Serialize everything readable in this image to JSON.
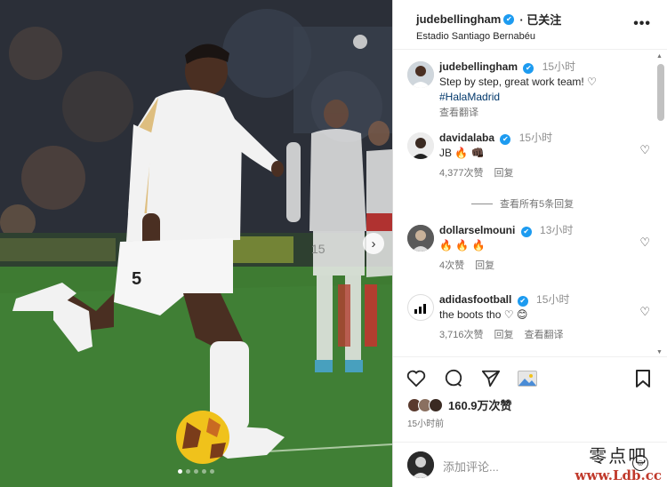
{
  "post": {
    "author": "judebellingham",
    "follow_state": "· 已关注",
    "location": "Estadio Santiago Bernabéu",
    "more": "•••",
    "photo": {
      "shirt_number": "5",
      "shirt_number_bg": "15",
      "carousel_dots": 5,
      "active_dot": 1
    }
  },
  "comments": [
    {
      "user": "judebellingham",
      "time": "15小时",
      "text": "Step by step, great work team! ♡",
      "hashtag": "#HalaMadrid",
      "translate": "查看翻译"
    },
    {
      "user": "davidalaba",
      "time": "15小时",
      "text": "JB 🔥 👊🏿",
      "likes": "4,377次赞",
      "reply": "回复",
      "view_replies": "查看所有5条回复"
    },
    {
      "user": "dollarselmouni",
      "time": "13小时",
      "text": "🔥 🔥 🔥",
      "likes": "4次赞",
      "reply": "回复"
    },
    {
      "user": "adidasfootball",
      "time": "15小时",
      "text": "the boots tho ♡ 😊",
      "likes": "3,716次赞",
      "reply": "回复",
      "translate": "查看翻译"
    }
  ],
  "actions": {
    "likes_count": "160.9万次赞",
    "post_time": "15小时前"
  },
  "add_comment": {
    "placeholder": "添加评论..."
  },
  "watermark": {
    "line1": "零点吧",
    "line2": "www.Ldb.cc"
  },
  "colors": {
    "verified": "#1d9bf0",
    "hashtag": "#00376b",
    "pitch": "#3c7a30",
    "kit": "#f2f2f2"
  }
}
